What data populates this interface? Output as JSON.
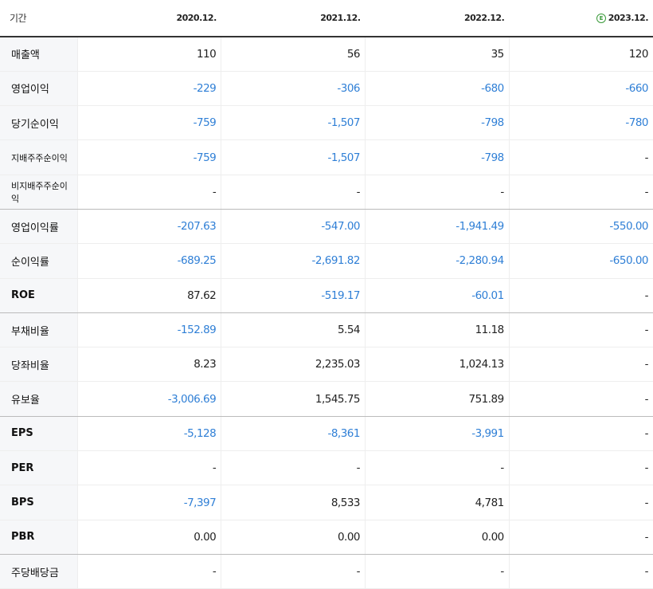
{
  "header": {
    "period_label": "기간",
    "columns": [
      "2020.12.",
      "2021.12.",
      "2022.12.",
      "2023.12."
    ],
    "estimate_badge": "E"
  },
  "rows": [
    {
      "label": "매출액",
      "values": [
        "110",
        "56",
        "35",
        "120"
      ]
    },
    {
      "label": "영업이익",
      "values": [
        "-229",
        "-306",
        "-680",
        "-660"
      ]
    },
    {
      "label": "당기순이익",
      "values": [
        "-759",
        "-1,507",
        "-798",
        "-780"
      ]
    },
    {
      "label": "지배주주순이익",
      "values": [
        "-759",
        "-1,507",
        "-798",
        "-"
      ]
    },
    {
      "label": "비지배주주순이익",
      "values": [
        "-",
        "-",
        "-",
        "-"
      ]
    },
    {
      "label": "영업이익률",
      "values": [
        "-207.63",
        "-547.00",
        "-1,941.49",
        "-550.00"
      ]
    },
    {
      "label": "순이익률",
      "values": [
        "-689.25",
        "-2,691.82",
        "-2,280.94",
        "-650.00"
      ]
    },
    {
      "label": "ROE",
      "values": [
        "87.62",
        "-519.17",
        "-60.01",
        "-"
      ]
    },
    {
      "label": "부채비율",
      "values": [
        "-152.89",
        "5.54",
        "11.18",
        "-"
      ]
    },
    {
      "label": "당좌비율",
      "values": [
        "8.23",
        "2,235.03",
        "1,024.13",
        "-"
      ]
    },
    {
      "label": "유보율",
      "values": [
        "-3,006.69",
        "1,545.75",
        "751.89",
        "-"
      ]
    },
    {
      "label": "EPS",
      "values": [
        "-5,128",
        "-8,361",
        "-3,991",
        "-"
      ]
    },
    {
      "label": "PER",
      "values": [
        "-",
        "-",
        "-",
        "-"
      ]
    },
    {
      "label": "BPS",
      "values": [
        "-7,397",
        "8,533",
        "4,781",
        "-"
      ]
    },
    {
      "label": "PBR",
      "values": [
        "0.00",
        "0.00",
        "0.00",
        "-"
      ]
    },
    {
      "label": "주당배당금",
      "values": [
        "-",
        "-",
        "-",
        "-"
      ]
    }
  ],
  "colors": {
    "negative": "#2f7fd6",
    "text": "#222222",
    "label_bg": "#f6f7f9",
    "estimate": "#3a9a3a"
  }
}
